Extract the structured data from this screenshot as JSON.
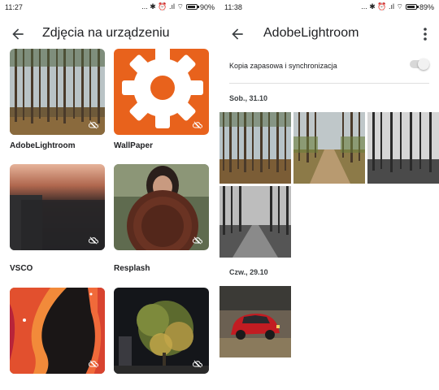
{
  "left": {
    "status": {
      "time": "11:27",
      "indicators": "... ✱ ⏰ .ıl ⌔",
      "battery": "90%"
    },
    "appbar": {
      "title": "Zdjęcia na urządzeniu",
      "back_icon": "arrow-back-icon"
    },
    "folders": [
      {
        "label": "AdobeLightroom",
        "icon": "cloud-off-icon"
      },
      {
        "label": "WallPaper",
        "icon": "cloud-off-icon"
      },
      {
        "label": "VSCO",
        "icon": "cloud-off-icon"
      },
      {
        "label": "Resplash",
        "icon": "cloud-off-icon"
      },
      {
        "label": "",
        "icon": "cloud-off-icon"
      },
      {
        "label": "",
        "icon": "cloud-off-icon"
      }
    ]
  },
  "right": {
    "status": {
      "time": "11:38",
      "indicators": "... ✱ ⏰ .ıl ⌔",
      "battery": "89%"
    },
    "appbar": {
      "title": "AdobeLightroom",
      "back_icon": "arrow-back-icon",
      "menu_icon": "more-vert-icon"
    },
    "sync": {
      "label": "Kopia zapasowa i synchronizacja",
      "enabled": false
    },
    "groups": [
      {
        "date": "Sob., 31.10",
        "photo_count": 4
      },
      {
        "date": "Czw., 29.10",
        "photo_count": 1
      }
    ]
  },
  "colors": {
    "wallpaper_orange": "#e8621c",
    "text": "#202124"
  }
}
